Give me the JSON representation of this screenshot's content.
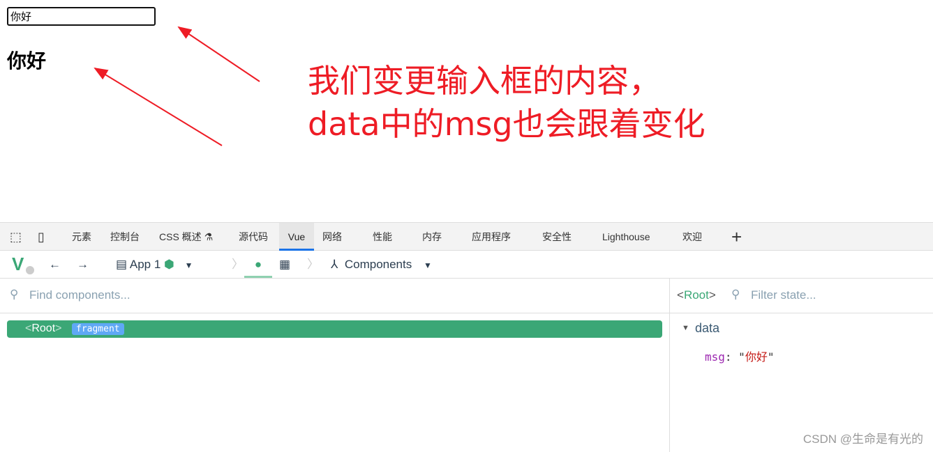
{
  "page": {
    "input_value": "你好",
    "heading": "你好"
  },
  "annotation": {
    "line1": "我们变更输入框的内容，",
    "line2": "data中的msg也会跟着变化",
    "color": "#ee1c25"
  },
  "devtools_tabs": [
    "元素",
    "控制台",
    "CSS 概述",
    "源代码",
    "Vue",
    "网络",
    "性能",
    "内存",
    "应用程序",
    "安全性",
    "Lighthouse",
    "欢迎"
  ],
  "active_tab": "Vue",
  "vue_toolbar": {
    "app": "App 1",
    "view": "Components"
  },
  "search": {
    "placeholder": "Find components..."
  },
  "tree": {
    "root": "Root",
    "badge": "fragment",
    "accent": "#3ba776"
  },
  "inspector": {
    "component": "Root",
    "filter_placeholder": "Filter state...",
    "section": "data",
    "key": "msg",
    "value": "你好"
  },
  "watermark": "CSDN @生命是有光的"
}
